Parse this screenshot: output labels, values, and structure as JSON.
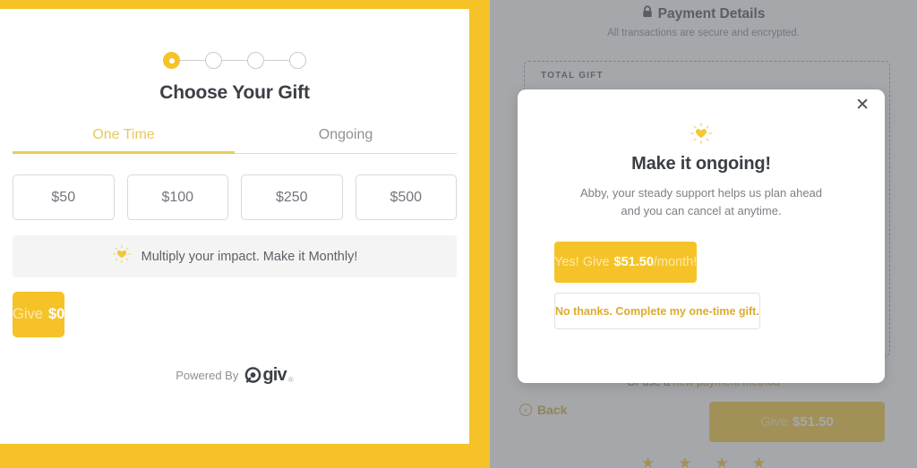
{
  "donation_card": {
    "steps": [
      {
        "state": "active"
      },
      {
        "state": "inactive"
      },
      {
        "state": "inactive"
      },
      {
        "state": "inactive"
      }
    ],
    "title": "Choose Your Gift",
    "tabs": [
      {
        "label": "One Time",
        "active": true
      },
      {
        "label": "Ongoing",
        "active": false
      }
    ],
    "amounts": [
      "$50",
      "$100",
      "$250",
      "$500"
    ],
    "upsell": {
      "icon": "sparkle-heart-icon",
      "text": "Multiply your impact. Make it Monthly!"
    },
    "give_button": {
      "label": "Give",
      "amount": "$0"
    },
    "footer": {
      "powered_by": "Powered By",
      "brand": "giv",
      "registered_mark": "®"
    }
  },
  "payment_panel": {
    "lock_icon": "lock-icon",
    "title": "Payment Details",
    "subtitle": "All transactions are secure and encrypted.",
    "box_label": "TOTAL GIFT",
    "new_method_prefix": "Or use a ",
    "new_method_link": "new payment method",
    "back_label": "Back",
    "back_icon": "circle-chevron-left-icon",
    "give_button": {
      "label": "Give",
      "amount": "$51.50"
    }
  },
  "modal": {
    "close_icon": "close-icon",
    "icon": "sparkle-heart-icon",
    "title": "Make it ongoing!",
    "body_line1": "Abby, your steady support helps us plan ahead",
    "body_line2": "and you can cancel at anytime.",
    "primary_button": {
      "prefix": "Yes! Give",
      "amount": "$51.50",
      "suffix": "/month!"
    },
    "secondary_button": {
      "label": "No thanks. Complete my one-time gift."
    }
  },
  "colors": {
    "brand_yellow": "#f5c328",
    "tab_active": "#e8c85c",
    "text_dark": "#3b3f45",
    "text_muted": "#7b7f85",
    "overlay": "rgba(110,113,118,0.62)"
  }
}
